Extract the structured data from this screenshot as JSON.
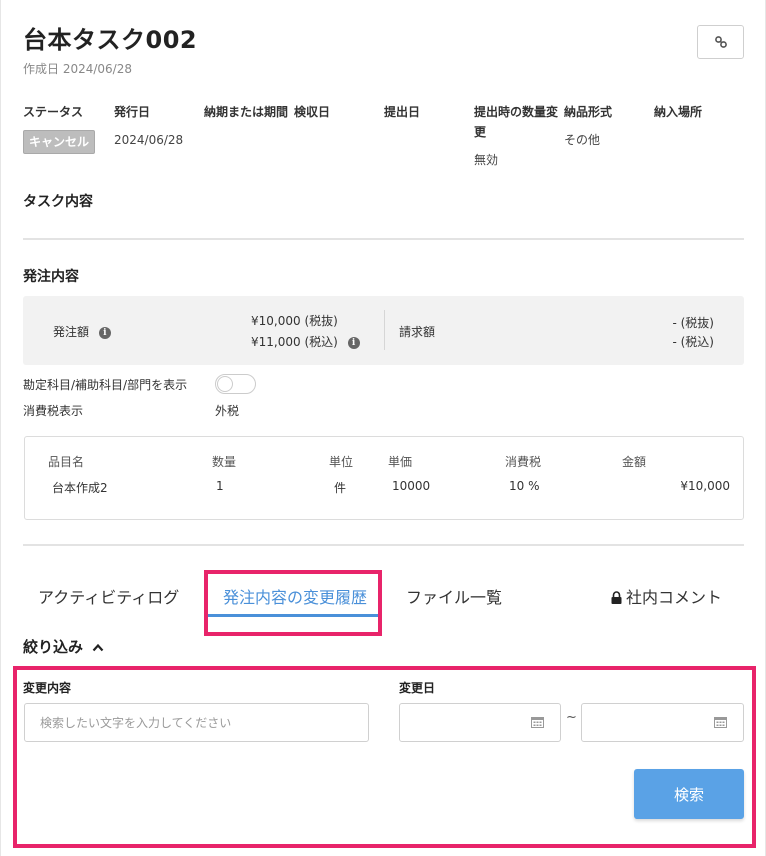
{
  "header": {
    "title": "台本タスク002",
    "created_label": "作成日 2024/06/28"
  },
  "meta": {
    "status_label": "ステータス",
    "status_value": "キャンセル",
    "issue_date_label": "発行日",
    "issue_date_value": "2024/06/28",
    "due_label": "納期または期間",
    "inspection_label": "検収日",
    "submit_label": "提出日",
    "qty_change_label": "提出時の数量変更",
    "qty_change_value": "無効",
    "delivery_format_label": "納品形式",
    "delivery_format_value": "その他",
    "delivery_place_label": "納入場所"
  },
  "task_content_heading": "タスク内容",
  "order": {
    "heading": "発注内容",
    "amount_label": "発注額",
    "amount_excl": "¥10,000 (税抜)",
    "amount_incl": "¥11,000 (税込)",
    "invoice_label": "請求額",
    "invoice_excl": "- (税抜)",
    "invoice_incl": "- (税込)"
  },
  "display_accounts_label": "勘定科目/補助科目/部門を表示",
  "tax_display_label": "消費税表示",
  "tax_display_value": "外税",
  "items_table": {
    "headers": [
      "品目名",
      "数量",
      "単位",
      "単価",
      "消費税",
      "金額"
    ],
    "rows": [
      [
        "台本作成2",
        "1",
        "件",
        "10000",
        "10 %",
        "¥10,000"
      ]
    ]
  },
  "tabs": [
    {
      "label": "アクティビティログ"
    },
    {
      "label": "発注内容の変更履歴"
    },
    {
      "label": "ファイル一覧"
    },
    {
      "label": "社内コメント"
    }
  ],
  "filter": {
    "heading": "絞り込み",
    "change_content_label": "変更内容",
    "change_content_placeholder": "検索したい文字を入力してください",
    "change_date_label": "変更日",
    "range_separator": "~",
    "search_button": "検索"
  },
  "colors": {
    "accent": "#4a90d9",
    "highlight": "#e8246a",
    "button": "#5aa2e6"
  }
}
